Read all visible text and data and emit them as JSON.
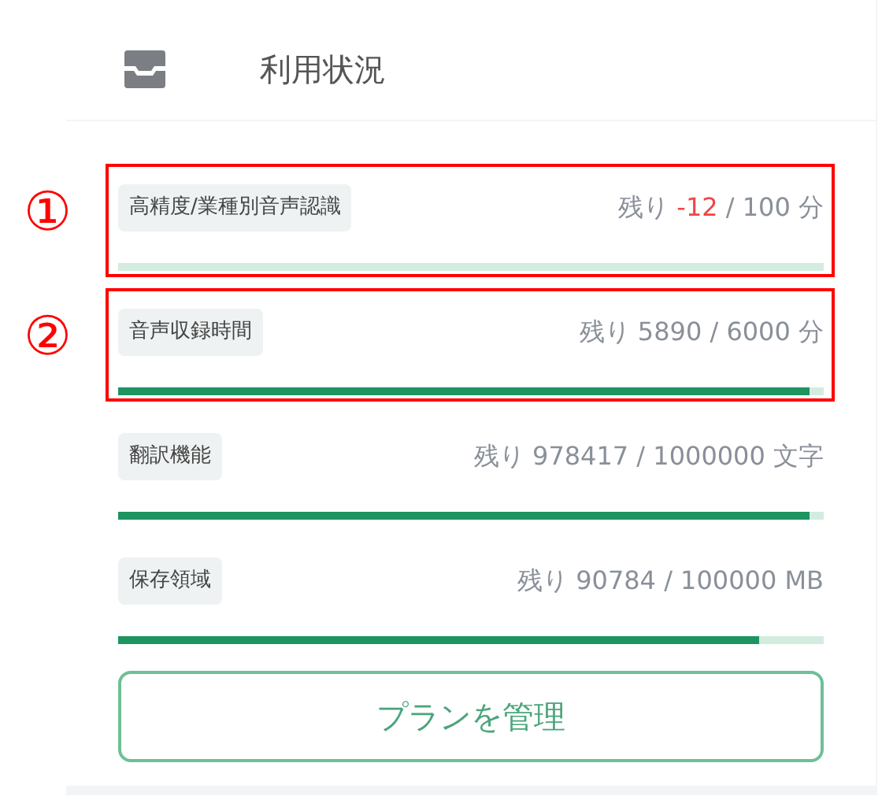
{
  "header": {
    "title": "利用状況"
  },
  "usage": [
    {
      "label": "高精度/業種別音声認識",
      "prefix": "残り",
      "remaining": "-12",
      "total": "/ 100 分",
      "over": true,
      "level": 0,
      "marker": "①"
    },
    {
      "label": "音声収録時間",
      "prefix": "残り",
      "remaining": "5890",
      "total": "/ 6000 分",
      "over": false,
      "level": 0.98,
      "marker": "②"
    },
    {
      "label": "翻訳機能",
      "prefix": "残り",
      "remaining": "978417",
      "total": "/ 1000000 文字",
      "over": false,
      "level": 0.98
    },
    {
      "label": "保存領域",
      "prefix": "残り",
      "remaining": "90784",
      "total": "/ 100000 MB",
      "over": false,
      "level": 0.908
    }
  ],
  "button": {
    "label": "プランを管理"
  }
}
